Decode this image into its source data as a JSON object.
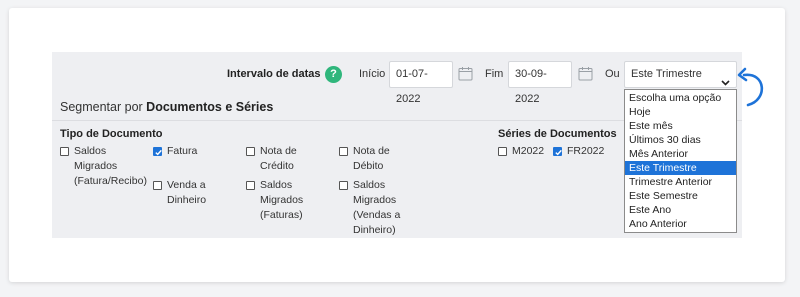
{
  "dates": {
    "label": "Intervalo de datas",
    "help": "?",
    "start_label": "Início",
    "start_value": "01-07-2022",
    "end_label": "Fim",
    "end_value": "30-09-2022",
    "or_label": "Ou"
  },
  "period": {
    "selected": "Este Trimestre",
    "options": [
      "Escolha uma opção",
      "Hoje",
      "Este mês",
      "Últimos 30 dias",
      "Mês Anterior",
      "Este Trimestre",
      "Trimestre Anterior",
      "Este Semestre",
      "Este Ano",
      "Ano Anterior"
    ],
    "selected_index": 5
  },
  "segment": {
    "prefix": "Segmentar por",
    "strong": "Documentos e Séries"
  },
  "doc_types": {
    "heading": "Tipo de Documento",
    "items": [
      {
        "lines": [
          "Saldos",
          "Migrados",
          "(Fatura/Recibo)"
        ],
        "checked": false
      },
      {
        "lines": [
          "Fatura"
        ],
        "checked": true
      },
      {
        "lines": [
          "Venda a",
          "Dinheiro"
        ],
        "checked": false
      },
      {
        "lines": [
          "Nota de",
          "Crédito"
        ],
        "checked": false
      },
      {
        "lines": [
          "Saldos",
          "Migrados",
          "(Faturas)"
        ],
        "checked": false
      },
      {
        "lines": [
          "Nota de",
          "Débito"
        ],
        "checked": false
      },
      {
        "lines": [
          "Saldos",
          "Migrados",
          "(Vendas a",
          "Dinheiro)"
        ],
        "checked": false
      }
    ]
  },
  "series": {
    "heading": "Séries de Documentos",
    "items": [
      {
        "label": "M2022",
        "checked": false
      },
      {
        "label": "FR2022",
        "checked": true
      }
    ]
  },
  "colors": {
    "accent": "#1e73d8",
    "help": "#2fb67c"
  },
  "icons": [
    "help-icon",
    "calendar-icon",
    "chevron-down-icon",
    "curved-arrow-icon",
    "checkmark-icon"
  ]
}
